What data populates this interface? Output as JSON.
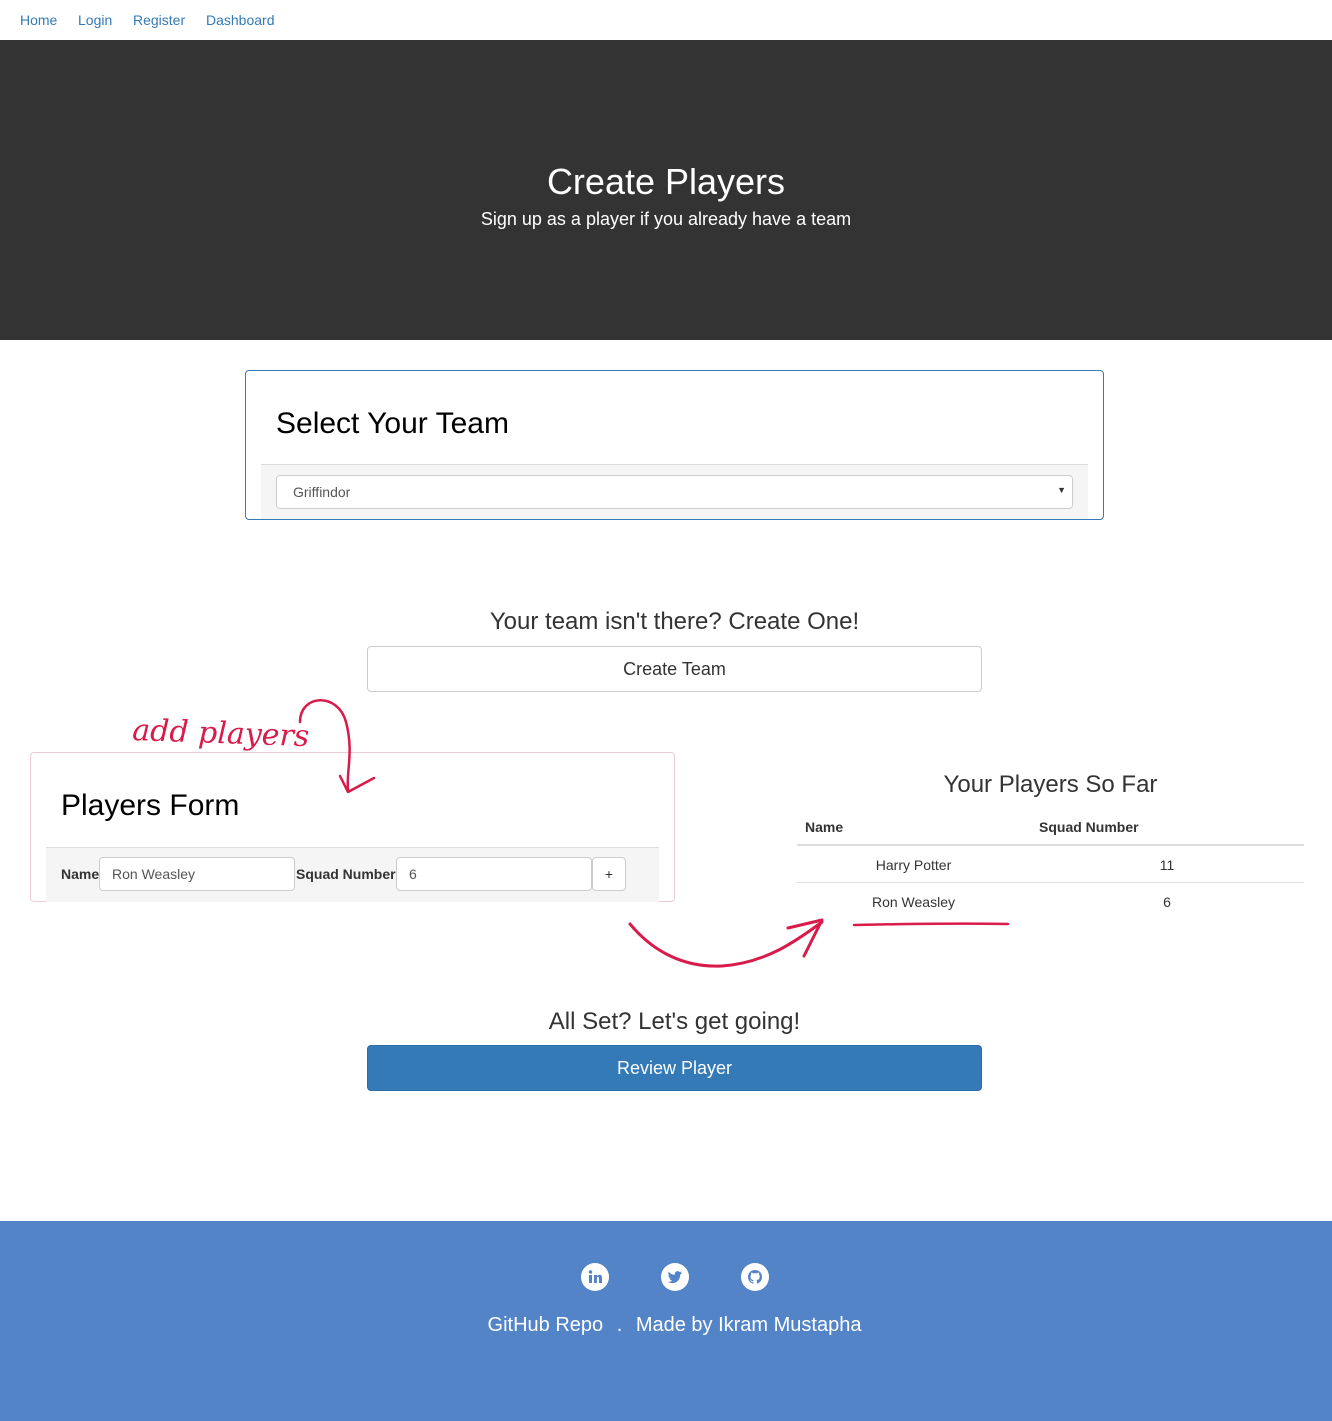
{
  "nav": {
    "items": [
      "Home",
      "Login",
      "Register",
      "Dashboard"
    ]
  },
  "hero": {
    "title": "Create Players",
    "subtitle": "Sign up as a player if you already have a team"
  },
  "team_select": {
    "heading": "Select Your Team",
    "selected": "Griffindor"
  },
  "create_team": {
    "question": "Your team isn't there? Create One!",
    "button_label": "Create Team"
  },
  "players_form": {
    "heading": "Players Form",
    "name_label": "Name",
    "name_value": "Ron Weasley",
    "squad_label": "Squad Number",
    "squad_value": "6",
    "add_label": "+"
  },
  "players_table": {
    "heading": "Your Players So Far",
    "columns": [
      "Name",
      "Squad Number"
    ],
    "rows": [
      {
        "name": "Harry Potter",
        "squad": "11"
      },
      {
        "name": "Ron Weasley",
        "squad": "6"
      }
    ]
  },
  "review": {
    "question": "All Set? Let's get going!",
    "button_label": "Review Player"
  },
  "annotation": {
    "text": "add players",
    "color": "#d81b4a"
  },
  "footer": {
    "icons": [
      "linkedin-icon",
      "twitter-icon",
      "github-icon"
    ],
    "repo_link": "GitHub Repo",
    "separator": ".",
    "credit": "Made by Ikram Mustapha"
  },
  "colors": {
    "hero_bg": "#333333",
    "primary": "#337ab7",
    "footer_bg": "#5484c8"
  }
}
